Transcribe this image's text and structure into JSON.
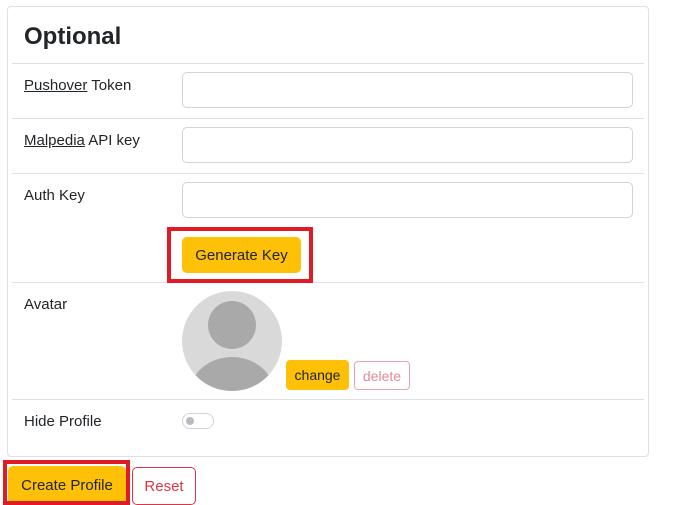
{
  "section": {
    "title": "Optional"
  },
  "pushover": {
    "label_link": "Pushover",
    "label_rest": " Token",
    "value": ""
  },
  "malpedia": {
    "label_link": "Malpedia",
    "label_rest": " API key",
    "value": ""
  },
  "auth_key": {
    "label": "Auth Key",
    "value": "",
    "generate_label": "Generate Key"
  },
  "avatar": {
    "label": "Avatar",
    "change_label": "change",
    "delete_label": "delete",
    "icon": "user-silhouette-icon"
  },
  "hide_profile": {
    "label": "Hide Profile",
    "enabled": false
  },
  "actions": {
    "create_label": "Create Profile",
    "reset_label": "Reset"
  },
  "colors": {
    "warning": "#ffc107",
    "danger": "#dc3545",
    "highlight": "#e01b24",
    "border": "#dee2e6"
  }
}
